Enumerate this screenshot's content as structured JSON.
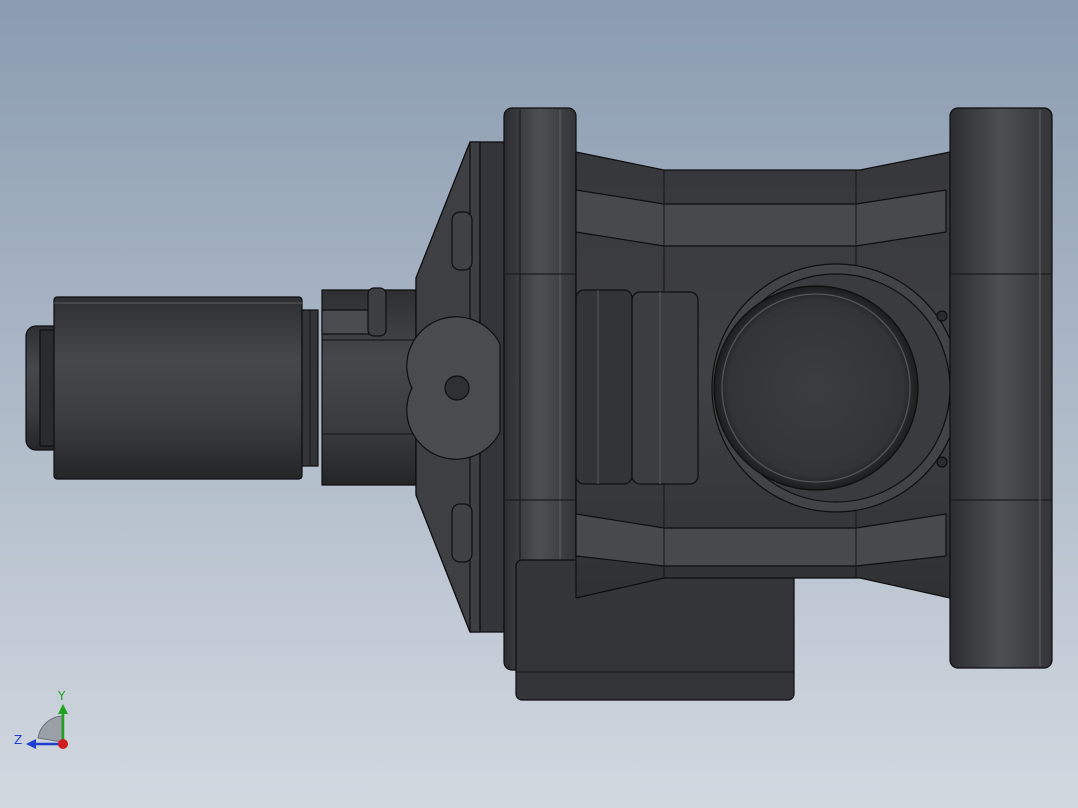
{
  "viewport": {
    "background_top": "#8a9cb0",
    "background_bottom": "#d2d8e0"
  },
  "model": {
    "body_color": "#3e3f42",
    "body_dark": "#2a2b2e",
    "body_light": "#55575b",
    "edge_color": "#0e0e0f"
  },
  "triad": {
    "y_label": "Y",
    "z_label": "Z",
    "y_color": "#1fa31f",
    "z_color": "#1f3fd0",
    "x_color": "#d01f1f"
  }
}
